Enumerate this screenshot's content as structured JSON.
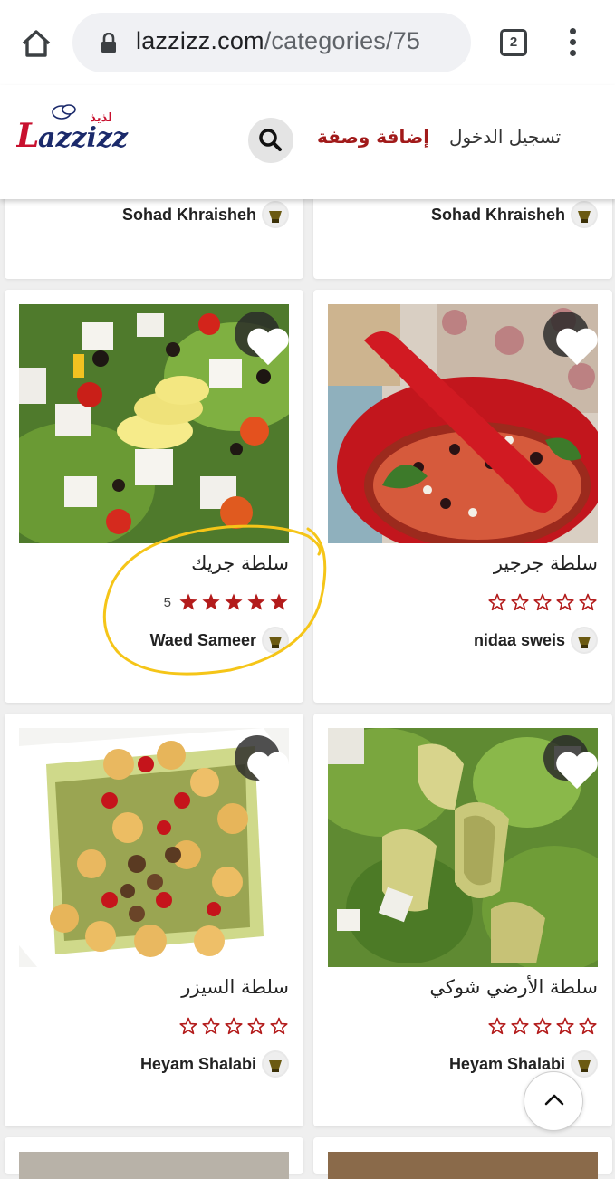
{
  "browser": {
    "url_host": "lazzizz.com",
    "url_path": "/categories/75",
    "tab_count": "2"
  },
  "header": {
    "login_label": "تسجيل الدخول",
    "add_recipe_label": "إضافة وصفة",
    "logo_text": "Lazzizz",
    "logo_arabic": "لذيذ"
  },
  "top_partial": {
    "left_author": "Sohad Khraisheh",
    "right_author": "Sohad Khraisheh"
  },
  "recipes": [
    {
      "title": "سلطة جريك",
      "rating": 5,
      "rating_count": "5",
      "author": "Waed Sameer"
    },
    {
      "title": "سلطة جرجير",
      "rating": 0,
      "rating_count": "",
      "author": "nidaa sweis"
    },
    {
      "title": "سلطة السيزر",
      "rating": 0,
      "rating_count": "",
      "author": "Heyam Shalabi"
    },
    {
      "title": "سلطة الأرضي شوكي",
      "rating": 0,
      "rating_count": "",
      "author": "Heyam Shalabi"
    }
  ],
  "colors": {
    "accent": "#a11a1a",
    "star": "#b31b1b",
    "annotation": "#f5c518"
  },
  "icons": {
    "home": "home-icon",
    "lock": "lock-icon",
    "menu": "more-vert-icon",
    "search": "search-icon",
    "favorite": "heart-icon",
    "scroll_top": "chevron-up-icon"
  }
}
